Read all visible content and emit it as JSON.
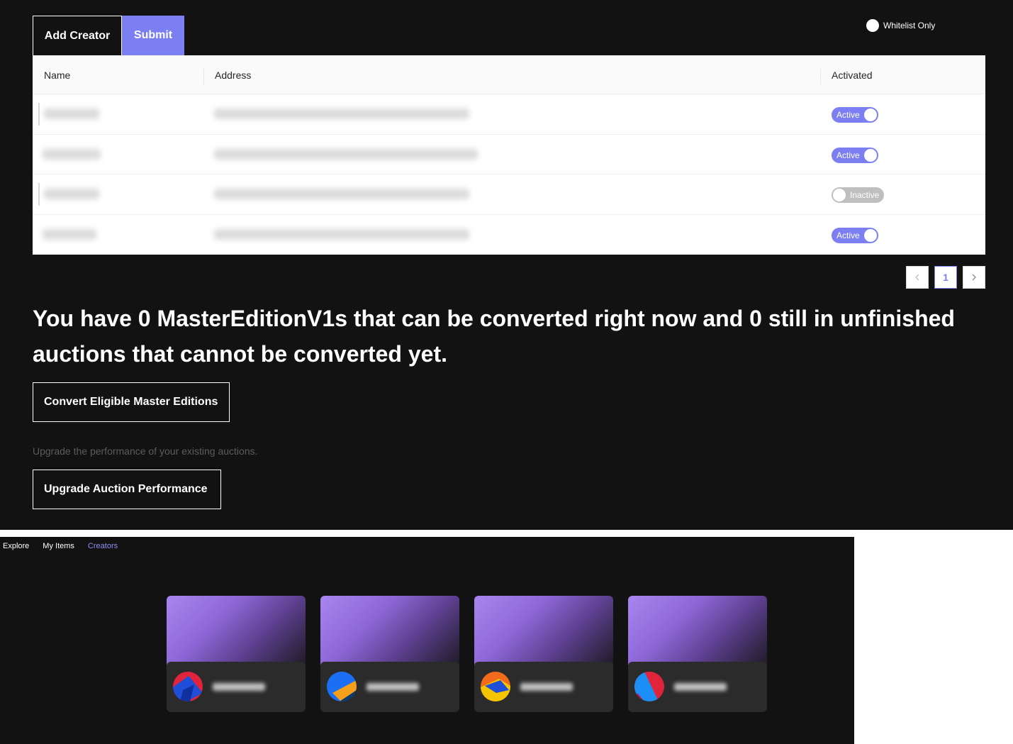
{
  "admin": {
    "add_creator_label": "Add Creator",
    "submit_label": "Submit",
    "whitelist_label": "Whitelist Only",
    "table": {
      "headers": [
        "Name",
        "Address",
        "Activated"
      ],
      "rows": [
        {
          "status": "Active",
          "active": true
        },
        {
          "status": "Active",
          "active": true
        },
        {
          "status": "Inactive",
          "active": false
        },
        {
          "status": "Active",
          "active": true
        }
      ]
    },
    "pagination": {
      "current_page": "1",
      "prev_icon": "chevron-left-icon",
      "next_icon": "chevron-right-icon"
    },
    "headline": "You have 0 MasterEditionV1s that can be converted right now and 0 still in unfinished auctions that cannot be converted yet.",
    "convert_label": "Convert Eligible Master Editions",
    "upgrade_note": "Upgrade the performance of your existing auctions.",
    "upgrade_label": "Upgrade Auction Performance"
  },
  "explore": {
    "nav": [
      {
        "label": "Explore",
        "active": false
      },
      {
        "label": "My Items",
        "active": false
      },
      {
        "label": "Creators",
        "active": true
      }
    ],
    "creator_cards": 4
  },
  "colors": {
    "accent": "#7b7ff2",
    "page_background": "#121212",
    "card_background": "#2b2b2b",
    "inactive_toggle": "#bfbfbf"
  }
}
